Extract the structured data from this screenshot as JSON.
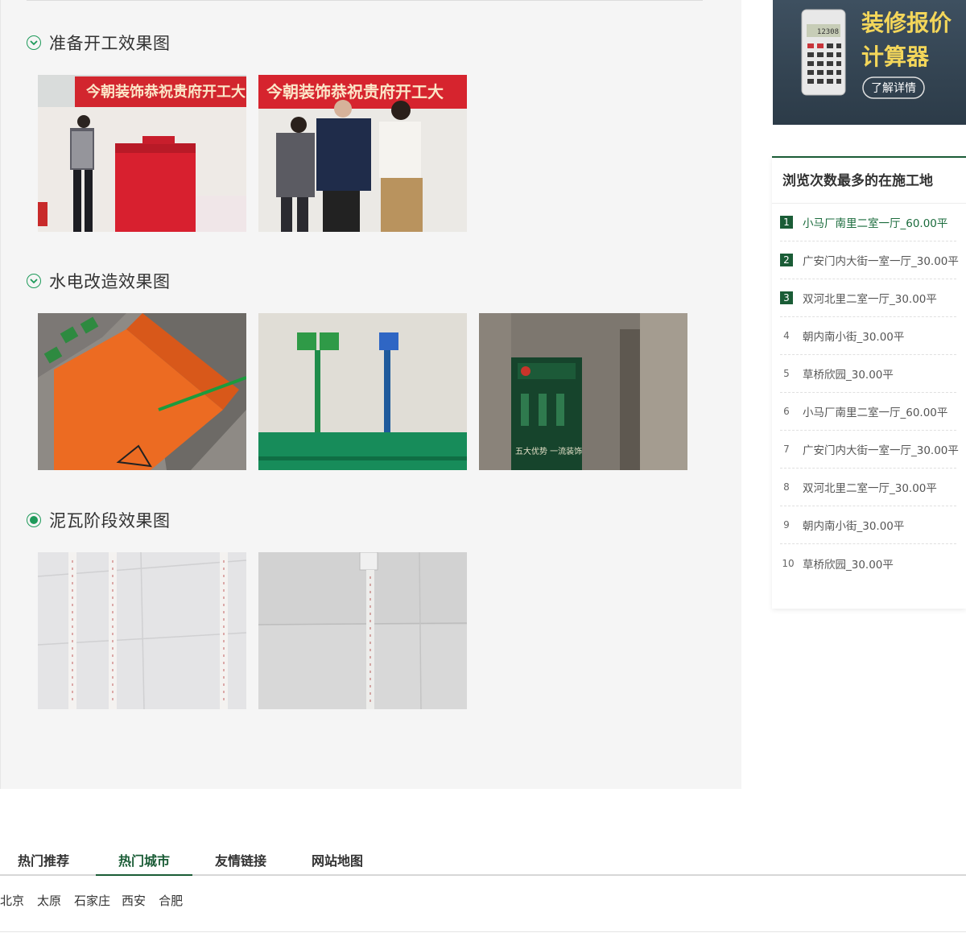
{
  "sections": [
    {
      "title": "准备开工效果图",
      "icon": "chevron-down-circle-icon"
    },
    {
      "title": "水电改造效果图",
      "icon": "chevron-down-circle-icon"
    },
    {
      "title": "泥瓦阶段效果图",
      "icon": "radio-selected-icon"
    }
  ],
  "photos": {
    "start_banner_1": "今朝装饰恭祝贵府开工大",
    "start_banner_2": "今朝装饰恭祝贵府开工大",
    "door_sign": "五大优势 一流装饰"
  },
  "banner": {
    "title_line1": "装修报价",
    "title_line2": "计算器",
    "button": "了解详情",
    "display": "12308"
  },
  "ranking": {
    "title": "浏览次数最多的在施工地",
    "items": [
      {
        "num": "1",
        "label": "小马厂南里二室一厅_60.00平"
      },
      {
        "num": "2",
        "label": "广安门内大街一室一厅_30.00平"
      },
      {
        "num": "3",
        "label": "双河北里二室一厅_30.00平"
      },
      {
        "num": "4",
        "label": "朝内南小街_30.00平"
      },
      {
        "num": "5",
        "label": "草桥欣园_30.00平"
      },
      {
        "num": "6",
        "label": "小马厂南里二室一厅_60.00平"
      },
      {
        "num": "7",
        "label": "广安门内大街一室一厅_30.00平"
      },
      {
        "num": "8",
        "label": "双河北里二室一厅_30.00平"
      },
      {
        "num": "9",
        "label": "朝内南小街_30.00平"
      },
      {
        "num": "10",
        "label": "草桥欣园_30.00平"
      }
    ]
  },
  "footer": {
    "tabs": [
      "热门推荐",
      "热门城市",
      "友情链接",
      "网站地图"
    ],
    "active_tab": "热门城市",
    "cities": [
      "北京",
      "太原",
      "石家庄",
      "西安",
      "合肥"
    ]
  },
  "colors": {
    "accent_green": "#1a5c36",
    "icon_green": "#1e9a5a",
    "panel_bg": "#f5f5f5"
  }
}
